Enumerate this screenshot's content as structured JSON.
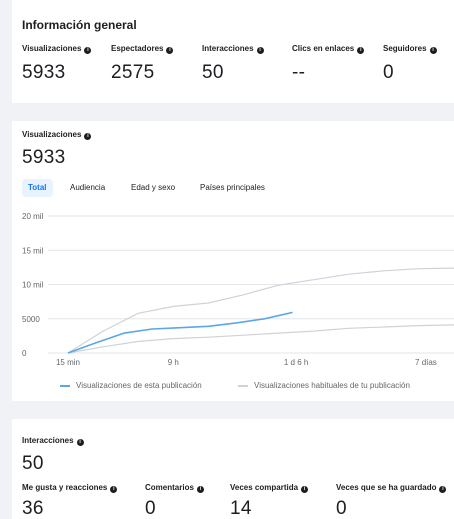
{
  "overview": {
    "title": "Información general",
    "stats": [
      {
        "label": "Visualizaciones",
        "value": "5933"
      },
      {
        "label": "Espectadores",
        "value": "2575"
      },
      {
        "label": "Interacciones",
        "value": "50"
      },
      {
        "label": "Clics en enlaces",
        "value": "--"
      },
      {
        "label": "Seguidores",
        "value": "0"
      }
    ]
  },
  "views": {
    "title": "Visualizaciones",
    "value": "5933",
    "tabs": [
      {
        "label": "Total",
        "active": true
      },
      {
        "label": "Audiencia",
        "active": false
      },
      {
        "label": "Edad y sexo",
        "active": false
      },
      {
        "label": "Países principales",
        "active": false
      }
    ]
  },
  "chart_data": {
    "type": "line",
    "x_ticks": [
      "15 min",
      "9 h",
      "1 d 6 h",
      "7 días"
    ],
    "y_ticks": [
      "0",
      "5000",
      "10 mil",
      "15 mil",
      "20 mil"
    ],
    "ylim": [
      0,
      20000
    ],
    "series": [
      {
        "name": "Visualizaciones de esta publicación",
        "color": "#5aa7e8",
        "x": [
          0,
          0.4,
          0.8,
          1.2,
          1.6,
          2.0,
          2.4,
          2.8,
          3.2
        ],
        "values": [
          0,
          1500,
          2900,
          3500,
          3700,
          3900,
          4400,
          5000,
          5933
        ]
      },
      {
        "name": "Visualizaciones habituales de tu publicación",
        "color": "#d0d2d6",
        "x": [
          0,
          0.5,
          1.0,
          1.5,
          2.0,
          2.5,
          3.0,
          3.5,
          4.0,
          4.5,
          5.0,
          5.5
        ],
        "values": [
          0,
          3200,
          5800,
          6800,
          7300,
          8500,
          9900,
          10700,
          11500,
          12000,
          12300,
          12400
        ]
      },
      {
        "name": "",
        "color": "#d0d2d6",
        "x": [
          0,
          0.5,
          1.0,
          1.5,
          2.0,
          2.5,
          3.0,
          3.5,
          4.0,
          4.5,
          5.0,
          5.5
        ],
        "values": [
          0,
          900,
          1700,
          2100,
          2300,
          2600,
          2900,
          3200,
          3600,
          3800,
          4000,
          4100
        ]
      }
    ]
  },
  "interactions": {
    "title": "Interacciones",
    "value": "50",
    "stats": [
      {
        "label": "Me gusta y reacciones",
        "value": "36"
      },
      {
        "label": "Comentarios",
        "value": "0"
      },
      {
        "label": "Veces compartida",
        "value": "14"
      },
      {
        "label": "Veces que se ha guardado",
        "value": "0"
      }
    ]
  }
}
